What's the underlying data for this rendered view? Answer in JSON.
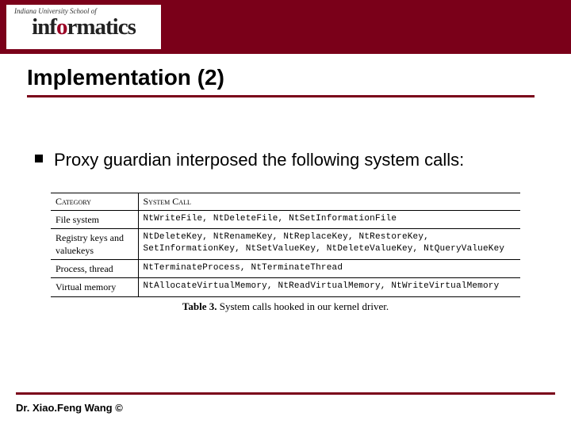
{
  "header": {
    "institution_top": "Indiana University School of",
    "institution_main_pre": "inf",
    "institution_main_dot": "o",
    "institution_main_post": "rmatics"
  },
  "title": "Implementation (2)",
  "bullet": "Proxy guardian interposed the following system calls:",
  "table": {
    "headers": [
      "Category",
      "System Call"
    ],
    "rows": [
      {
        "category": "File system",
        "calls": "NtWriteFile, NtDeleteFile, NtSetInformationFile"
      },
      {
        "category": "Registry keys and valuekeys",
        "calls": "NtDeleteKey, NtRenameKey, NtReplaceKey, NtRestoreKey, SetInformationKey, NtSetValueKey, NtDeleteValueKey, NtQueryValueKey"
      },
      {
        "category": "Process, thread",
        "calls": "NtTerminateProcess, NtTerminateThread"
      },
      {
        "category": "Virtual memory",
        "calls": "NtAllocateVirtualMemory, NtReadVirtualMemory, NtWriteVirtualMemory"
      }
    ],
    "caption_label": "Table 3.",
    "caption_text": " System calls hooked in our kernel driver."
  },
  "footer": "Dr. Xiao.Feng Wang  ©"
}
